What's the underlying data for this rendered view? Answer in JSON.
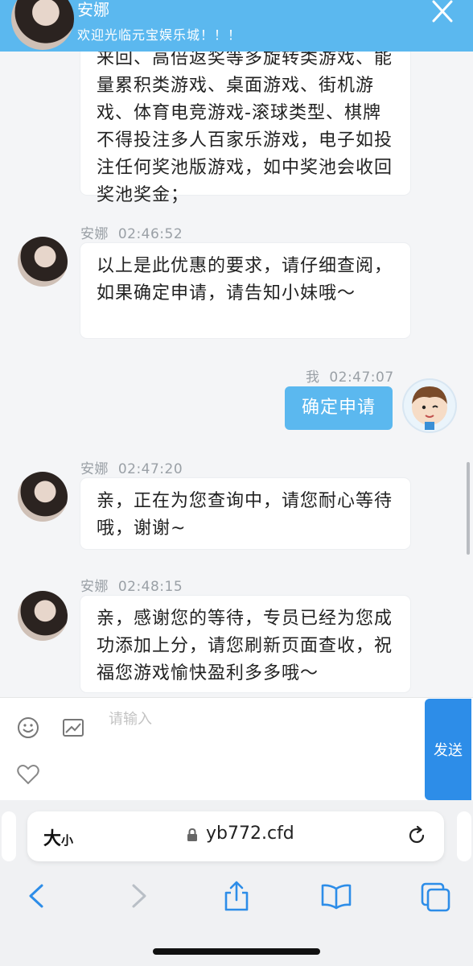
{
  "header": {
    "agent_name": "安娜",
    "welcome": "欢迎光临元宝娱乐城！！！"
  },
  "messages": [
    {
      "sender": "",
      "time": "",
      "text": "来回、高倍返奖等多旋转类游戏、能量累积类游戏、桌面游戏、街机游戏、体育电竞游戏-滚球类型、棋牌不得投注多人百家乐游戏，电子如投注任何奖池版游戏，如中奖池会收回奖池奖金；"
    },
    {
      "sender": "安娜",
      "time": "02:46:52",
      "text": "以上是此优惠的要求，请仔细查阅，如果确定申请，请告知小妹哦～"
    },
    {
      "sender": "我",
      "time": "02:47:07",
      "text": "确定申请"
    },
    {
      "sender": "安娜",
      "time": "02:47:20",
      "text": "亲，正在为您查询中，请您耐心等待哦，谢谢~"
    },
    {
      "sender": "安娜",
      "time": "02:48:15",
      "text": "亲，感谢您的等待，专员已经为您成功添加上分，请您刷新页面查收，祝福您游戏愉快盈利多多哦～"
    }
  ],
  "input": {
    "placeholder": "请输入",
    "send_label": "发送",
    "icons": [
      "emoji-icon",
      "image-icon",
      "heart-icon"
    ]
  },
  "browser": {
    "text_size_label": "大",
    "text_size_small": "小",
    "domain": "yb772.cfd",
    "nav_icons": [
      "back-icon",
      "forward-icon",
      "share-icon",
      "bookmarks-icon",
      "tabs-icon"
    ]
  },
  "colors": {
    "header_bg": "#5bb8ef",
    "my_bubble": "#5bb8ef",
    "send_button": "#2d8de8"
  }
}
